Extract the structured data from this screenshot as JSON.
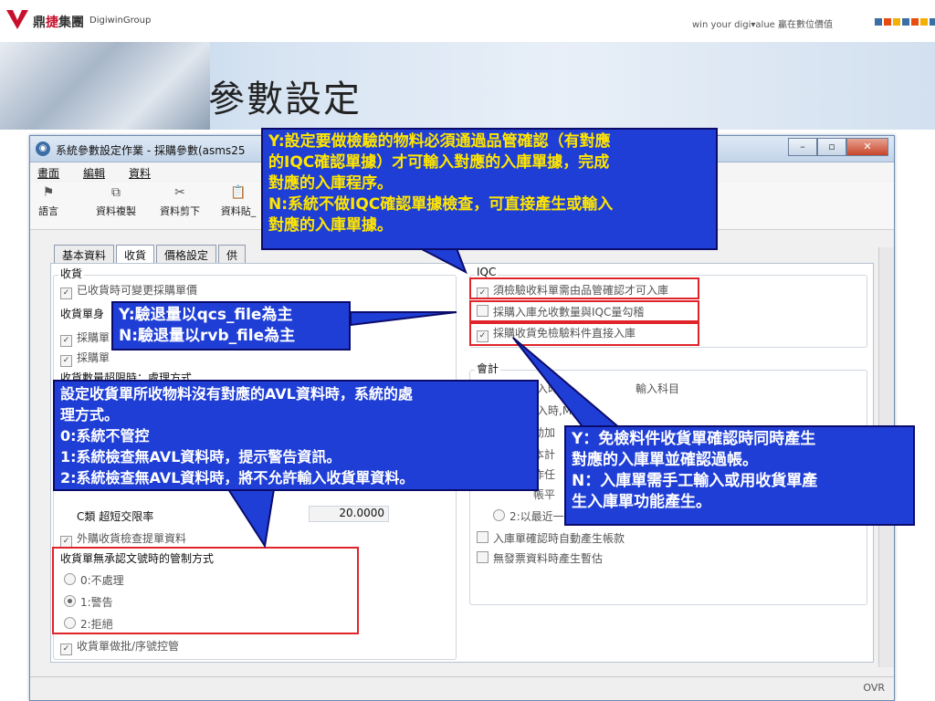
{
  "header": {
    "brand_cn": "鼎捷集團",
    "brand_cn_highlight": "捷",
    "brand_en": "DigiwinGroup",
    "tagline": "win your digi▾alue 贏在數位價值",
    "tag_colors": [
      "#3a6ea5",
      "#e84d0e",
      "#f3b000",
      "#3a6ea5",
      "#e84d0e",
      "#f3b000",
      "#3a6ea5"
    ],
    "slide_title": "參數設定"
  },
  "window": {
    "title": "系統參數設定作業 - 採購參數(asms25",
    "controls": [
      "–",
      "▫",
      "✕"
    ],
    "menu": [
      "畫面",
      "編輯",
      "資料"
    ],
    "toolbar": [
      {
        "icon": "flag-icon",
        "label": "語言"
      },
      {
        "icon": "copy-icon",
        "label": "資料複製"
      },
      {
        "icon": "cut-icon",
        "label": "資料剪下"
      },
      {
        "icon": "paste-icon",
        "label": "資料貼_"
      }
    ],
    "tabs": [
      "基本資料",
      "收貨",
      "價格設定",
      "供"
    ],
    "active_tab": "收貨",
    "status_ovr": "OVR"
  },
  "receive": {
    "group_label": "收貨",
    "opt_change_price": "已收貨時可變更採購單價",
    "receipt_label": "收貨單身",
    "opt_purchase_1": "採購單",
    "opt_purchase_2": "採購單",
    "over_receipt_heading": "收貨數量超限時：處理方式",
    "c_rate_label": "C類 超短交限率",
    "c_rate_value": "20.0000",
    "opt_outsource_check": "外購收貨檢查提單資料",
    "unapproved_group": "收貨單無承認文號時的管制方式",
    "unapproved_options": [
      "0:不處理",
      "1:警告",
      "2:拒絕"
    ],
    "unapproved_selected": 1,
    "opt_batch_serial": "收貨單做批/序號控管"
  },
  "iqc": {
    "group_label": "IQC",
    "opt_require_confirm": "須檢驗收料單需由品管確認才可入庫",
    "opt_allow_qty": "採購入庫允收數量與IQC量勾稽",
    "opt_exempt_direct": "採購收貨免檢驗料件直接入庫"
  },
  "accounting": {
    "group_label": "會計",
    "rows": [
      "輸入時,",
      "輸入科目",
      "輸入時,MISC",
      "動加",
      "本計",
      "作任",
      "帳平",
      "2:以最近一"
    ],
    "opt_auto_voucher": "入庫單確認時自動產生帳款",
    "opt_no_invoice": "無發票資料時產生暫估"
  },
  "callouts": {
    "iqc_confirm": [
      "Y:設定要做檢驗的物料必須通過品管確認（有對應",
      "的IQC確認單據）才可輸入對應的入庫單據，完成",
      "對應的入庫程序。",
      "N:系統不做IQC確認單據檢查，可直接產生或輸入",
      "對應的入庫單據。"
    ],
    "return_qty": [
      "Y:驗退量以qcs_file為主",
      "N:驗退量以rvb_file為主"
    ],
    "avl": [
      "設定收貨單所收物料沒有對應的AVL資料時，系統的處",
      "理方式。",
      "0:系統不管控",
      "1:系統檢查無AVL資料時，提示警告資訊。",
      "2:系統檢查無AVL資料時，將不允許輸入收貨單資料。"
    ],
    "exempt": [
      "Y：免檢料件收貨單確認時同時產生",
      "對應的入庫單並確認過帳。",
      "N：入庫單需手工輸入或用收貨單產",
      "生入庫單功能產生。"
    ]
  }
}
